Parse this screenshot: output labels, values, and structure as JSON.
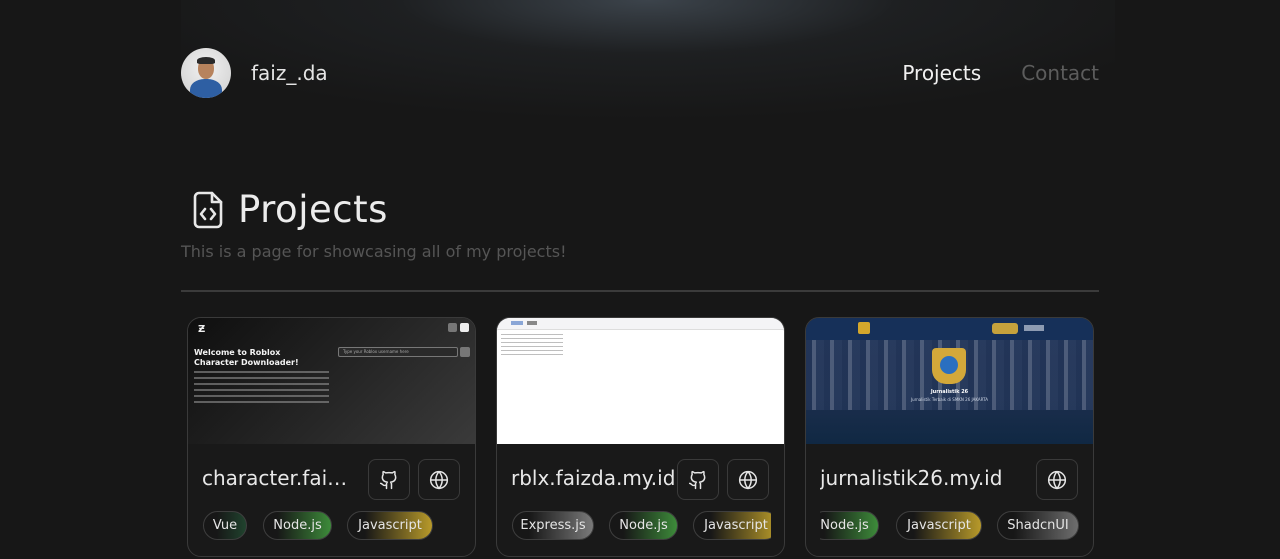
{
  "header": {
    "brand": "faiz_.da",
    "nav": [
      {
        "label": "Projects",
        "active": true
      },
      {
        "label": "Contact",
        "active": false
      }
    ]
  },
  "page": {
    "title": "Projects",
    "subtitle": "This is a page for showcasing all of my projects!",
    "title_icon": "file-code-icon"
  },
  "projects": [
    {
      "title": "character.faiz...",
      "buttons": [
        "github-icon",
        "globe-icon"
      ],
      "tags": [
        "Vue",
        "Node.js",
        "Javascript"
      ],
      "preview": {
        "heading": "Welcome to Roblox Character Downloader!",
        "input_placeholder": "Type your Roblox username here",
        "logo": "Ƶ"
      }
    },
    {
      "title": "rblx.faizda.my.id",
      "buttons": [
        "github-icon",
        "globe-icon"
      ],
      "tags": [
        "Express.js",
        "Node.js",
        "Javascript"
      ]
    },
    {
      "title": "jurnalistik26.my.id",
      "buttons": [
        "globe-icon"
      ],
      "tags": [
        "Node.js",
        "Javascript",
        "ShadcnUI"
      ],
      "preview": {
        "heading": "Jurnalistik 26",
        "subheading": "Jurnalistik Terbaik di SMKN 26 JAKARTA"
      }
    }
  ],
  "colors": {
    "background": "#171717",
    "vue": "#1f3a2a",
    "node": "#3c8a3a",
    "javascript": "#b89a2a",
    "express": "#7a7a7a",
    "shadcn": "#6e6e6e"
  }
}
